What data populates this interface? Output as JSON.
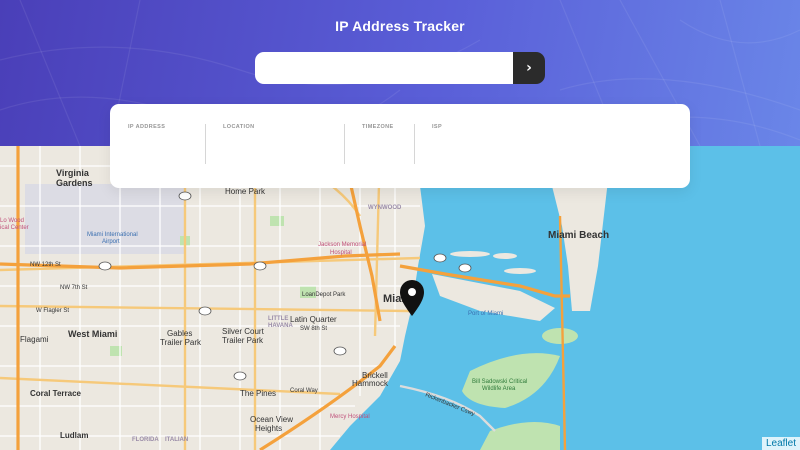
{
  "header": {
    "title": "IP Address Tracker"
  },
  "search": {
    "value": "",
    "placeholder": "",
    "submit_icon": "chevron-right-icon",
    "submit_glyph": "›"
  },
  "info": {
    "ip_label": "IP ADDRESS",
    "ip_value": "",
    "location_label": "LOCATION",
    "location_value": "",
    "timezone_label": "TIMEZONE",
    "timezone_value": "",
    "isp_label": "ISP",
    "isp_value": ""
  },
  "map": {
    "attribution": "Leaflet",
    "marker_icon": "location-pin-icon",
    "places": {
      "virginia": "Virginia",
      "gardens": "Gardens",
      "miami_beach": "Miami Beach",
      "miami": "Miami",
      "west_miami": "West Miami",
      "coral_terrace": "Coral Terrace",
      "ludlam": "Ludlam",
      "flagami": "Flagami",
      "gables": "Gables",
      "trailer_park": "Trailer Park",
      "silver_court": "Silver Court",
      "silver_trailer": "Trailer Park",
      "little": "LITTLE",
      "havana": "HAVANA",
      "latin_quarter": "Latin Quarter",
      "brickell": "Brickell",
      "hammock": "Hammock",
      "the_pines": "The Pines",
      "ocean_view": "Ocean View",
      "heights": "Heights",
      "home_park": "Home Park",
      "wynwood": "WYNWOOD",
      "airport": "Miami International",
      "airport2": "Airport",
      "jackson": "Jackson Memorial",
      "hospital": "Hospital",
      "loandepot": "LoanDepot Park",
      "port": "Port of Miami",
      "bill1": "Bill Sadowski Critical",
      "bill2": "Wildlife Area",
      "mercy": "Mercy Hospital",
      "lowood": "Lo Wood",
      "medical": "ical Center",
      "flagler": "W Flagler St",
      "nw12": "NW 12th St",
      "nw7": "NW 7th St",
      "sw8": "SW 8th St",
      "coral_way": "Coral Way",
      "rickenbacker": "Rickenbacker Cswy",
      "florida": "FLORIDA",
      "italian": "ITALIAN"
    }
  },
  "colors": {
    "accent": "#5a5fd8",
    "button_bg": "#2b2b2b",
    "water": "#5cc0e8"
  }
}
